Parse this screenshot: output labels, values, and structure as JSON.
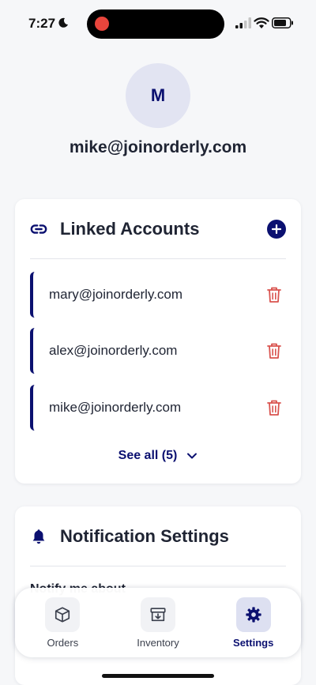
{
  "status": {
    "time": "7:27"
  },
  "profile": {
    "initial": "M",
    "email": "mike@joinorderly.com"
  },
  "linked": {
    "title": "Linked Accounts",
    "accounts": [
      {
        "email": "mary@joinorderly.com"
      },
      {
        "email": "alex@joinorderly.com"
      },
      {
        "email": "mike@joinorderly.com"
      }
    ],
    "see_all": "See all (5)"
  },
  "notifications": {
    "title": "Notification Settings",
    "subtitle": "Notify me about"
  },
  "tabs": [
    {
      "label": "Orders",
      "icon": "box-icon",
      "active": false
    },
    {
      "label": "Inventory",
      "icon": "archive-icon",
      "active": false
    },
    {
      "label": "Settings",
      "icon": "gear-icon",
      "active": true
    }
  ],
  "colors": {
    "accent": "#0b1070",
    "danger": "#d9534f",
    "background": "#f6f7f9"
  }
}
